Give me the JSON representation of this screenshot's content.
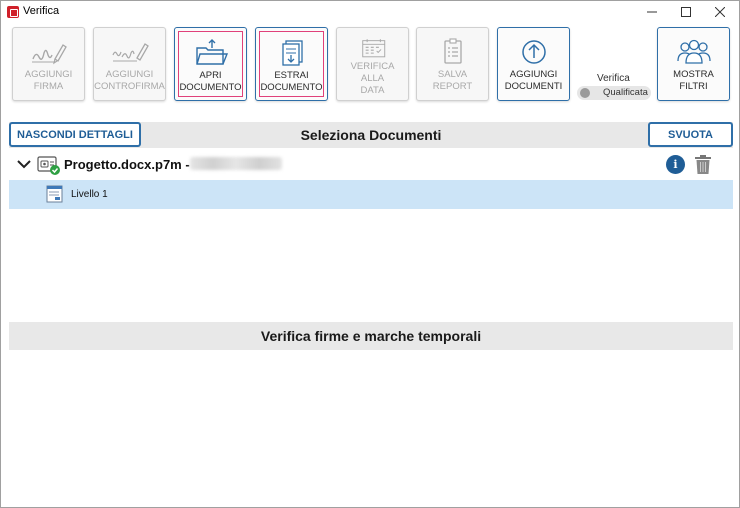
{
  "window": {
    "title": "Verifica",
    "controls": {
      "minimize": "—",
      "maximize": "☐",
      "close": "✕"
    }
  },
  "toolbar": {
    "buttons": [
      {
        "label_line1": "AGGIUNGI",
        "label_line2": "FIRMA",
        "icon": "signature-pen-icon",
        "enabled": false
      },
      {
        "label_line1": "AGGIUNGI",
        "label_line2": "CONTROFIRMA",
        "icon": "countersignature-pen-icon",
        "enabled": false
      },
      {
        "label_line1": "APRI",
        "label_line2": "DOCUMENTO",
        "icon": "open-folder-icon",
        "enabled": true
      },
      {
        "label_line1": "ESTRAI",
        "label_line2": "DOCUMENTO",
        "icon": "extract-document-icon",
        "enabled": true
      },
      {
        "label_line1": "VERIFICA ALLA",
        "label_line2": "DATA",
        "icon": "calendar-icon",
        "enabled": false
      },
      {
        "label_line1": "SALVA",
        "label_line2": "REPORT",
        "icon": "report-icon",
        "enabled": false
      },
      {
        "label_line1": "AGGIUNGI",
        "label_line2": "DOCUMENTI",
        "icon": "upload-circle-icon",
        "enabled": true
      },
      {
        "label_line1": "MOSTRA",
        "label_line2": "FILTRI",
        "icon": "users-group-icon",
        "enabled": true
      }
    ],
    "verifica": {
      "label": "Verifica",
      "toggle_text": "Qualificata",
      "toggle_on": false
    }
  },
  "select_section": {
    "title": "Seleziona Documenti",
    "hide_details_label": "NASCONDI DETTAGLI",
    "clear_label": "SVUOTA"
  },
  "documents": [
    {
      "name": "Progetto.docx.p7m -",
      "expanded": true,
      "verified": true,
      "levels": [
        {
          "label": "Livello 1"
        }
      ]
    }
  ],
  "verify_section": {
    "title": "Verifica firme e marche temporali"
  },
  "colors": {
    "accent": "#1f5d96",
    "focus_border": "#e0407a",
    "selected_row": "#cce4f7",
    "section_bar": "#e8e8e8",
    "app_icon": "#d0202a"
  }
}
